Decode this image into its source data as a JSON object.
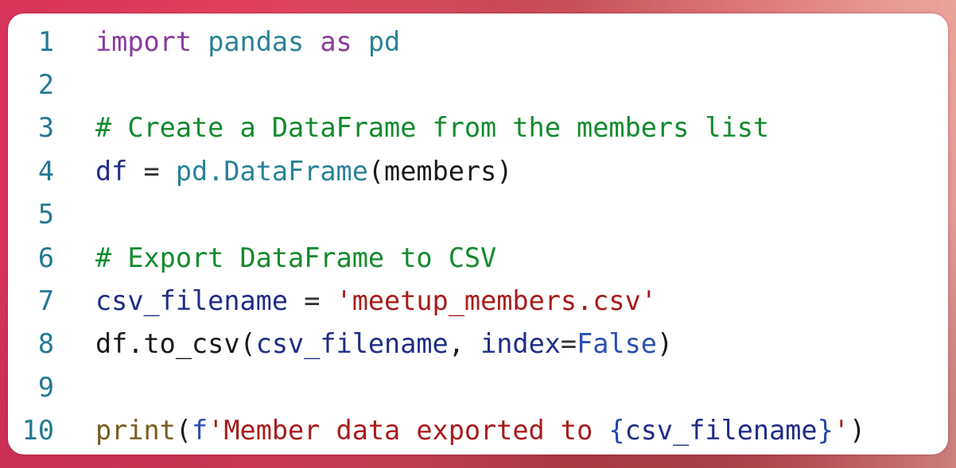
{
  "colors": {
    "line_number": "#237893",
    "keyword": "#8b3a9e",
    "module": "#2a8299",
    "comment": "#138a2e",
    "variable": "#1f2d86",
    "string": "#a81c1c",
    "constant": "#2a4fb0",
    "function": "#7a5c1f"
  },
  "code": {
    "language": "python",
    "lines": [
      {
        "number": "1",
        "text": "import pandas as pd",
        "tokens": [
          "import",
          " ",
          "pandas",
          " ",
          "as",
          " ",
          "pd"
        ]
      },
      {
        "number": "2",
        "text": ""
      },
      {
        "number": "3",
        "text": "# Create a DataFrame from the members list",
        "tokens": [
          "# Create a DataFrame from the members list"
        ]
      },
      {
        "number": "4",
        "text": "df = pd.DataFrame(members)",
        "tokens": [
          "df",
          " = ",
          "pd.DataFrame",
          "(members)"
        ]
      },
      {
        "number": "5",
        "text": ""
      },
      {
        "number": "6",
        "text": "# Export DataFrame to CSV",
        "tokens": [
          "# Export DataFrame to CSV"
        ]
      },
      {
        "number": "7",
        "text": "csv_filename = 'meetup_members.csv'",
        "tokens": [
          "csv_filename",
          " = ",
          "'meetup_members.csv'"
        ]
      },
      {
        "number": "8",
        "text": "df.to_csv(csv_filename, index=False)",
        "tokens": [
          "df.to_csv(",
          "csv_filename",
          ", ",
          "index",
          "=",
          "False",
          ")"
        ]
      },
      {
        "number": "9",
        "text": ""
      },
      {
        "number": "10",
        "text": "print(f'Member data exported to {csv_filename}')",
        "tokens": [
          "print",
          "(",
          "f",
          "'Member data exported to ",
          "{",
          "csv_filename",
          "}",
          "'",
          ")"
        ]
      }
    ]
  }
}
